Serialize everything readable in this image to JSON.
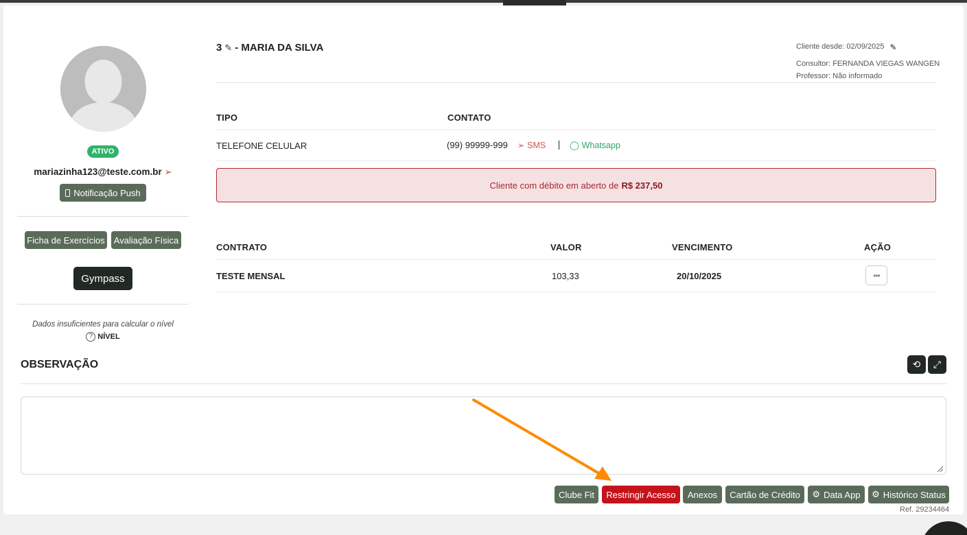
{
  "client": {
    "id": "3",
    "name_suffix": "- MARIA DA SILVA",
    "status": "ATIVO",
    "email": "mariazinha123@teste.com.br",
    "cliente_desde": "Cliente desde: 02/09/2025",
    "consultor": "Consultor: FERNANDA VIEGAS WANGEN",
    "professor": "Professor: Não informado"
  },
  "left_panel": {
    "push_button": "Notificação Push",
    "ficha_button": "Ficha de Exercícios",
    "avaliacao_button": "Avaliação Física",
    "gympass_button": "Gympass",
    "nivel_message": "Dados insuficientes para calcular o nível",
    "nivel_label": "NÍVEL"
  },
  "contacts": {
    "headers": [
      "TIPO",
      "CONTATO"
    ],
    "rows": [
      {
        "tipo": "TELEFONE CELULAR",
        "contato": "(99) 99999-999",
        "sms_label": "SMS",
        "whatsapp_label": "Whatsapp"
      }
    ]
  },
  "alert": {
    "text": "Cliente com débito em aberto de",
    "amount": "R$ 237,50"
  },
  "contracts": {
    "headers": [
      "CONTRATO",
      "VALOR",
      "VENCIMENTO",
      "AÇÃO"
    ],
    "rows": [
      {
        "contrato": "TESTE MENSAL",
        "valor": "103,33",
        "vencimento": "20/10/2025"
      }
    ]
  },
  "observacao": {
    "title": "OBSERVAÇÃO",
    "value": ""
  },
  "bottom_buttons": {
    "clube_fit": "Clube Fit",
    "restringir": "Restringir Acesso",
    "anexos": "Anexos",
    "cartao": "Cartão de Crédito",
    "data_app": "Data App",
    "historico": "Histórico Status"
  },
  "ref": "Ref. 29234464",
  "colors": {
    "accent_green": "#5a6b5a",
    "status_green": "#2fb36b",
    "danger_red": "#c4131b",
    "annotation_arrow": "#ff8a00"
  }
}
